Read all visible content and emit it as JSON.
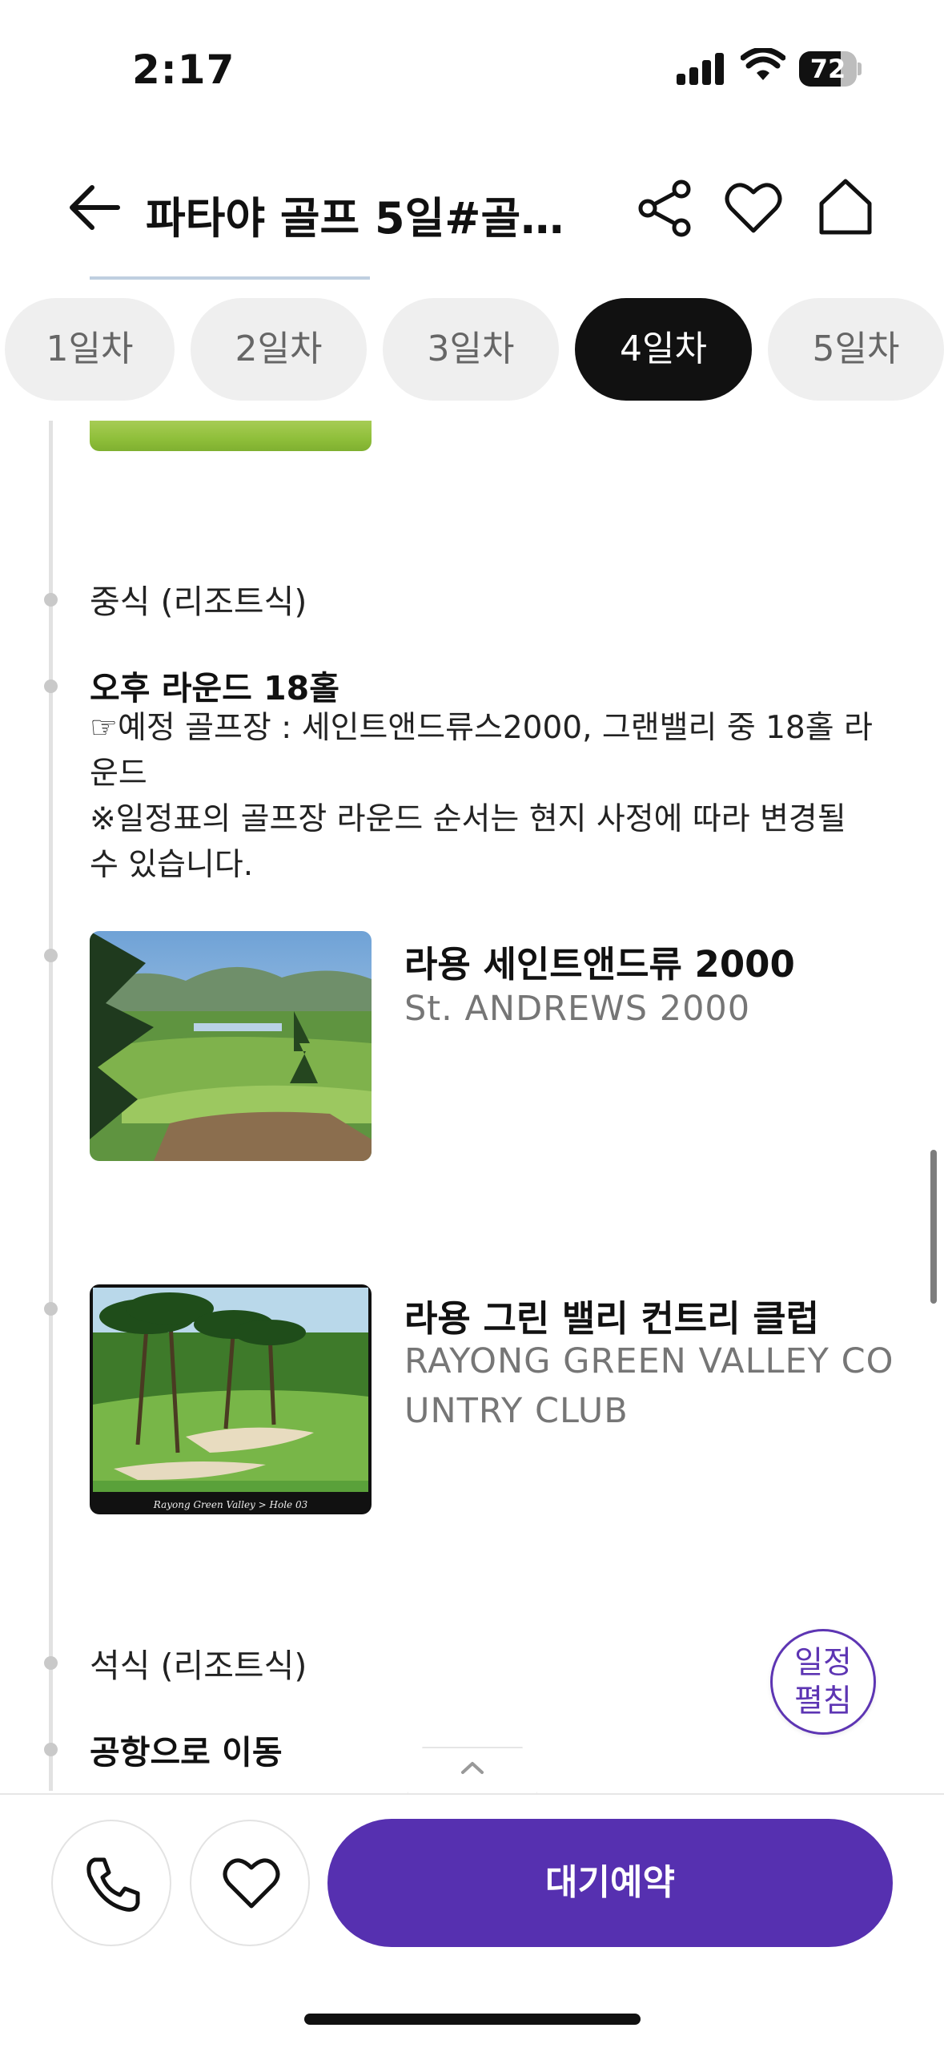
{
  "status_bar": {
    "time": "2:17",
    "battery": "72",
    "battery_level": 0.72
  },
  "header": {
    "title": "파타야 골프 5일#골프..."
  },
  "tabs": [
    {
      "label": "1일차",
      "active": false
    },
    {
      "label": "2일차",
      "active": false
    },
    {
      "label": "3일차",
      "active": false
    },
    {
      "label": "4일차",
      "active": true
    },
    {
      "label": "5일차",
      "active": false
    }
  ],
  "schedule": {
    "lunch": "중식 (리조트식)",
    "round_title": "오후 라운드 18홀",
    "round_lines": [
      "☞예정 골프장 : 세인트앤드류스2000, 그랜밸리 중 18홀 라운드",
      "※일정표의 골프장 라운드 순서는 현지 사정에 따라 변경될 수 있습니다."
    ],
    "courses": [
      {
        "name": "라용 세인트앤드류 2000",
        "english": "St. ANDREWS 2000"
      },
      {
        "name": "라용 그린 밸리 컨트리 클럽",
        "english": "RAYONG GREEN VALLEY COUNTRY CLUB",
        "image_caption": "Rayong Green Valley > Hole 03"
      }
    ],
    "dinner": "석식 (리조트식)",
    "transfer": "공항으로 이동"
  },
  "fab": {
    "line1": "일정",
    "line2": "펼침"
  },
  "bottom_bar": {
    "reserve_label": "대기예약"
  },
  "colors": {
    "accent": "#5630b0",
    "active_tab": "#111111",
    "tab_bg": "#efefef"
  },
  "icons": [
    "back-arrow-icon",
    "share-icon",
    "heart-icon",
    "home-icon",
    "phone-icon",
    "chevron-up-icon"
  ]
}
